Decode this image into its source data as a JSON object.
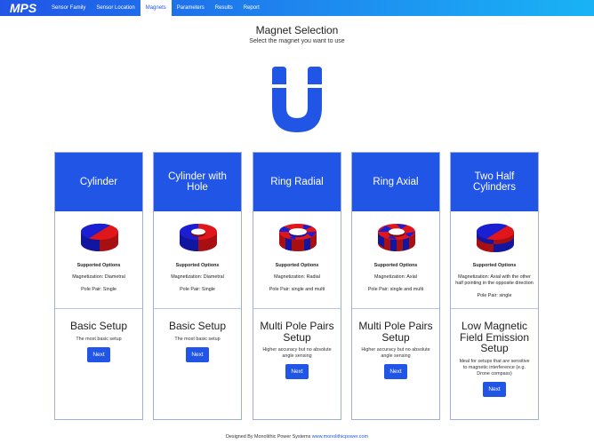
{
  "nav": {
    "logo_text": "MPS",
    "items": [
      {
        "label": "Sensor Family",
        "active": false
      },
      {
        "label": "Sensor Location",
        "active": false
      },
      {
        "label": "Magnets",
        "active": true
      },
      {
        "label": "Parameters",
        "active": false
      },
      {
        "label": "Results",
        "active": false
      },
      {
        "label": "Report",
        "active": false
      }
    ]
  },
  "page": {
    "title": "Magnet Selection",
    "subtitle": "Select the magnet you want to use",
    "hero_icon": "horseshoe-magnet-icon"
  },
  "cards": [
    {
      "title": "Cylinder",
      "image": "cylinder-magnet-diametral",
      "options_title": "Supported Options",
      "magnetization": "Magnetization: Diametral",
      "pole_pair": "Pole Pair: Single",
      "setup_title": "Basic Setup",
      "setup_desc": "The most basic setup",
      "button": "Next"
    },
    {
      "title": "Cylinder with Hole",
      "image": "cylinder-with-hole-magnet",
      "options_title": "Supported Options",
      "magnetization": "Magnetization: Diametral",
      "pole_pair": "Pole Pair: Single",
      "setup_title": "Basic Setup",
      "setup_desc": "The most basic setup",
      "button": "Next"
    },
    {
      "title": "Ring Radial",
      "image": "ring-radial-magnet",
      "options_title": "Supported Options",
      "magnetization": "Magnetization: Radial",
      "pole_pair": "Pole Pair: single and multi",
      "setup_title": "Multi Pole Pairs Setup",
      "setup_desc": "Higher accuracy but no absolute angle sensing",
      "button": "Next"
    },
    {
      "title": "Ring Axial",
      "image": "ring-axial-magnet",
      "options_title": "Supported Options",
      "magnetization": "Magnetization: Axial",
      "pole_pair": "Pole Pair: single and multi",
      "setup_title": "Multi Pole Pairs Setup",
      "setup_desc": "Higher accuracy but no absolute angle sensing",
      "button": "Next"
    },
    {
      "title": "Two Half Cylinders",
      "image": "two-half-cylinders-magnet",
      "options_title": "Supported Options",
      "magnetization": "Magnetization: Axial with the other half pointing in the opposite direction",
      "pole_pair": "Pole Pair: single",
      "setup_title": "Low Magnetic Field Emission Setup",
      "setup_desc": "Ideal for setups that are sensitive to magnetic interference (e.g. Drone compass)",
      "button": "Next"
    }
  ],
  "footer": {
    "text": "Designed By Monolithic Power Systems",
    "link": "www.monolithicpower.com"
  },
  "colors": {
    "primary": "#2155e6",
    "magnet_red": "#e0161b",
    "magnet_blue": "#1a1fd1"
  }
}
